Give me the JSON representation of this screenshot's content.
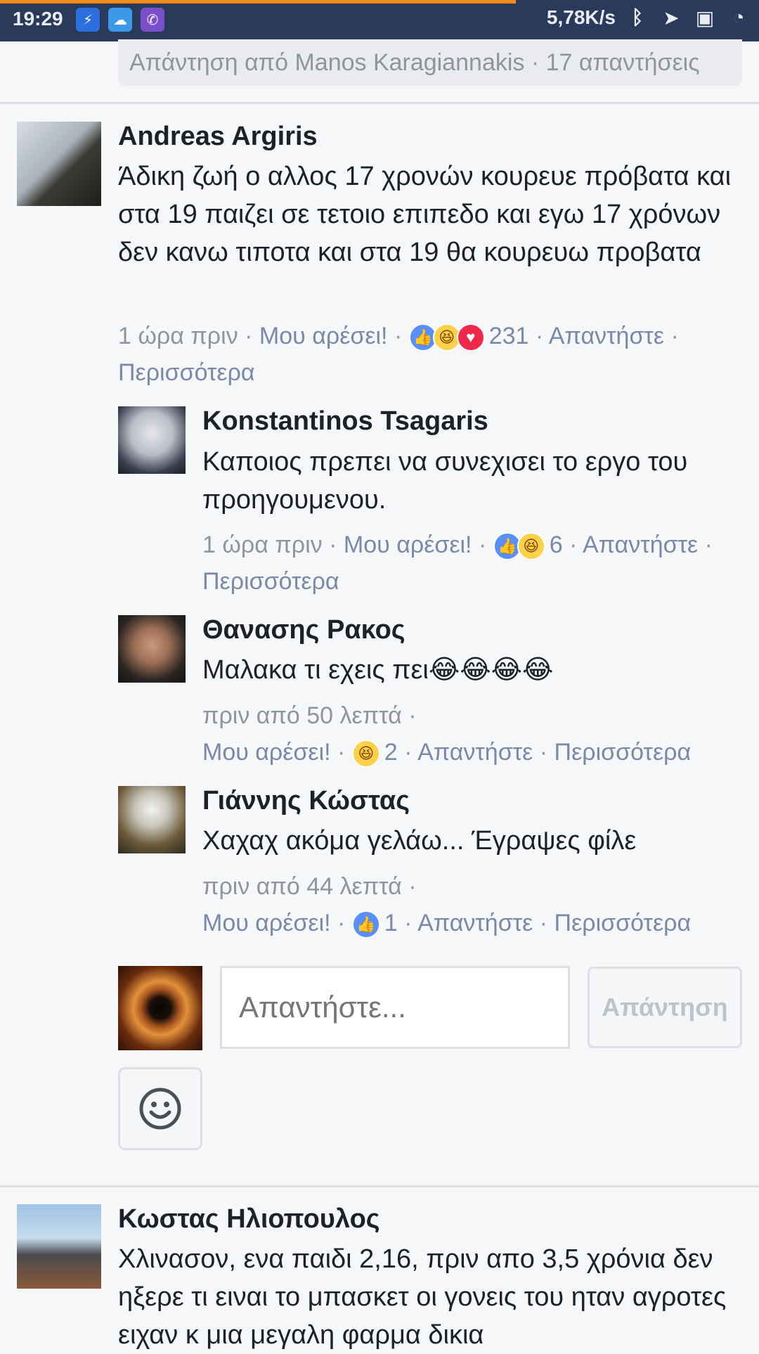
{
  "status_bar": {
    "time": "19:29",
    "speed": "5,78K/s",
    "loading_progress": 0.68,
    "apps": [
      "messenger-icon",
      "weather-icon",
      "viber-icon"
    ],
    "right_icons": [
      "bluetooth-icon",
      "location-icon",
      "nfc-icon",
      "sync-icon"
    ]
  },
  "reply_banner": {
    "text": "Απάντηση από Manos Karagiannakis · 17 απαντήσεις"
  },
  "comments": [
    {
      "author": "Andreas Argiris",
      "text": "Άδικη ζωή ο αλλος 17 χρονών κουρευε πρόβατα και στα 19 παιζει σε τετοιο επιπεδο και εγω 17 χρόνων δεν κανω τιποτα και στα 19 θα κουρευω προβατα",
      "time": "1 ώρα πριν",
      "like_label": "Μου αρέσει!",
      "reactions": [
        "like",
        "haha",
        "love"
      ],
      "reaction_count": "231",
      "reply_label": "Απαντήστε",
      "more_label": "Περισσότερα"
    },
    {
      "author": "Konstantinos Tsagaris",
      "text": "Καποιος πρεπει να συνεχισει το εργο του προηγουμενου.",
      "time": "1 ώρα πριν",
      "like_label": "Μου αρέσει!",
      "reactions": [
        "like",
        "haha"
      ],
      "reaction_count": "6",
      "reply_label": "Απαντήστε",
      "more_label": "Περισσότερα"
    },
    {
      "author": "Θανασης Ρακος",
      "text": "Μαλακα τι εχεις πει",
      "text_emoji": "😂😂😂😂",
      "time": "πριν από 50 λεπτά",
      "like_label": "Μου αρέσει!",
      "reactions": [
        "haha"
      ],
      "reaction_count": "2",
      "reply_label": "Απαντήστε",
      "more_label": "Περισσότερα"
    },
    {
      "author": "Γιάννης Κώστας",
      "text": "Χαχαχ ακόμα γελάω... Έγραψες φίλε",
      "time": "πριν από 44 λεπτά",
      "like_label": "Μου αρέσει!",
      "reactions": [
        "like"
      ],
      "reaction_count": "1",
      "reply_label": "Απαντήστε",
      "more_label": "Περισσότερα"
    },
    {
      "author": "Κωστας Ηλιοπουλος",
      "text": "Χλινασον, ενα παιδι 2,16, πριν απο 3,5 χρόνια δεν ηξερε τι ειναι το μπασκετ οι γονεις του ηταν αγροτες ειχαν κ μια μεγαλη φαρμα δικια"
    }
  ],
  "reply_box": {
    "placeholder": "Απαντήστε...",
    "button_label": "Απάντηση",
    "emoji_button_icon": "smiley-icon"
  },
  "colors": {
    "status_bar": "#293a5a",
    "loading": "#ff8a1a",
    "meta_link": "#7b89a8",
    "like": "#5890ff",
    "love": "#f0284a",
    "haha": "#ffd04a"
  }
}
